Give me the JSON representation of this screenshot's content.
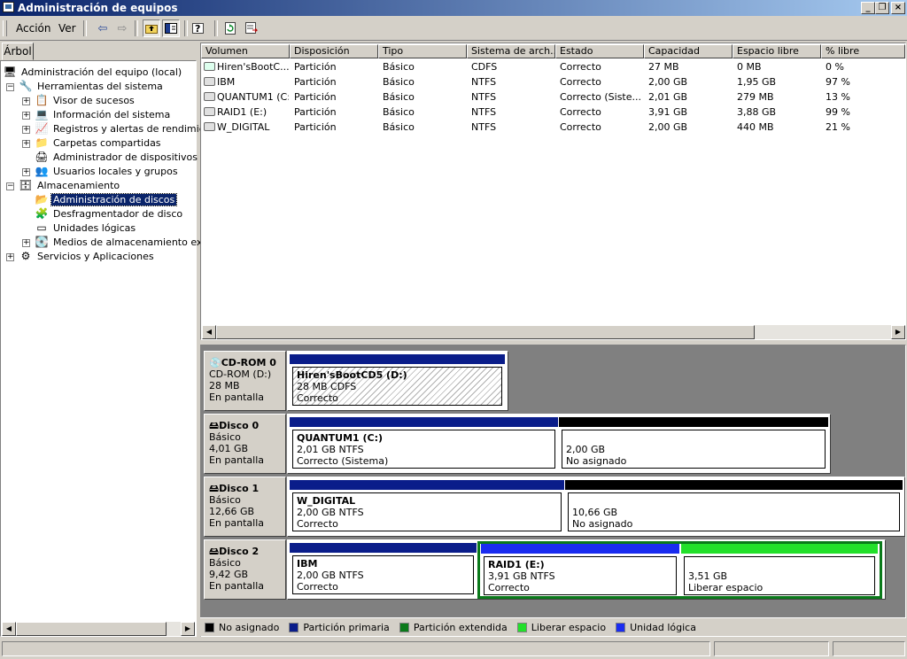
{
  "window": {
    "title": "Administración de equipos"
  },
  "menu": {
    "accion": "Acción",
    "ver": "Ver"
  },
  "toolbar": {
    "icons": [
      "back-arrow-icon",
      "forward-arrow-icon",
      "up-folder-icon",
      "show-hide-tree-icon",
      "help-icon",
      "refresh-icon",
      "export-list-icon"
    ]
  },
  "left_tab": {
    "label": "Árbol"
  },
  "tree": {
    "root": "Administración del equipo (local)",
    "herramientas": "Herramientas del sistema",
    "visor": "Visor de sucesos",
    "informacion": "Información del sistema",
    "registros": "Registros y alertas de rendimiento",
    "carpetas": "Carpetas compartidas",
    "admin_disp": "Administrador de dispositivos",
    "usuarios": "Usuarios locales y grupos",
    "almacenamiento": "Almacenamiento",
    "admin_discos": "Administración de discos",
    "desfrag": "Desfragmentador de disco",
    "unidades": "Unidades lógicas",
    "medios": "Medios de almacenamiento extraíbles",
    "servicios": "Servicios y Aplicaciones"
  },
  "columns": [
    "Volumen",
    "Disposición",
    "Tipo",
    "Sistema de arch...",
    "Estado",
    "Capacidad",
    "Espacio libre",
    "% libre"
  ],
  "volumes": [
    {
      "volumen": "Hiren'sBootC...",
      "disposicion": "Partición",
      "tipo": "Básico",
      "sistema": "CDFS",
      "estado": "Correcto",
      "capacidad": "27 MB",
      "libre": "0 MB",
      "pct": "0 %"
    },
    {
      "volumen": "IBM",
      "disposicion": "Partición",
      "tipo": "Básico",
      "sistema": "NTFS",
      "estado": "Correcto",
      "capacidad": "2,00 GB",
      "libre": "1,95 GB",
      "pct": "97 %"
    },
    {
      "volumen": "QUANTUM1 (C:)",
      "disposicion": "Partición",
      "tipo": "Básico",
      "sistema": "NTFS",
      "estado": "Correcto (Siste...",
      "capacidad": "2,01 GB",
      "libre": "279 MB",
      "pct": "13 %"
    },
    {
      "volumen": "RAID1 (E:)",
      "disposicion": "Partición",
      "tipo": "Básico",
      "sistema": "NTFS",
      "estado": "Correcto",
      "capacidad": "3,91 GB",
      "libre": "3,88 GB",
      "pct": "99 %"
    },
    {
      "volumen": "W_DIGITAL",
      "disposicion": "Partición",
      "tipo": "Básico",
      "sistema": "NTFS",
      "estado": "Correcto",
      "capacidad": "2,00 GB",
      "libre": "440 MB",
      "pct": "21 %"
    }
  ],
  "disks": {
    "cdrom": {
      "name": "CD-ROM 0",
      "l1": "CD-ROM (D:)",
      "l2": "28 MB",
      "l3": "En pantalla",
      "p1": {
        "name": "Hiren'sBootCD5  (D:)",
        "size": "28 MB CDFS",
        "status": "Correcto"
      }
    },
    "d0": {
      "name": "Disco 0",
      "l1": "Básico",
      "l2": "4,01 GB",
      "l3": "En pantalla",
      "p1": {
        "name": "QUANTUM1  (C:)",
        "size": "2,01 GB NTFS",
        "status": "Correcto (Sistema)"
      },
      "p2": {
        "size": "2,00 GB",
        "status": "No asignado"
      }
    },
    "d1": {
      "name": "Disco 1",
      "l1": "Básico",
      "l2": "12,66 GB",
      "l3": "En pantalla",
      "p1": {
        "name": "W_DIGITAL",
        "size": "2,00 GB NTFS",
        "status": "Correcto"
      },
      "p2": {
        "size": "10,66 GB",
        "status": "No asignado"
      }
    },
    "d2": {
      "name": "Disco 2",
      "l1": "Básico",
      "l2": "9,42 GB",
      "l3": "En pantalla",
      "p1": {
        "name": "IBM",
        "size": "2,00 GB NTFS",
        "status": "Correcto"
      },
      "p2": {
        "name": "RAID1  (E:)",
        "size": "3,91 GB NTFS",
        "status": "Correcto"
      },
      "p3": {
        "size": "3,51 GB",
        "status": "Liberar espacio"
      }
    }
  },
  "legend": [
    {
      "label": "No asignado",
      "color": "#000000"
    },
    {
      "label": "Partición primaria",
      "color": "#0a1d8a"
    },
    {
      "label": "Partición extendida",
      "color": "#0a7a1a"
    },
    {
      "label": "Liberar espacio",
      "color": "#22e02a"
    },
    {
      "label": "Unidad lógica",
      "color": "#1a2cf0"
    }
  ],
  "colors": {
    "primary": "#0a1d8a",
    "unallocated": "#000000",
    "extended": "#0a7a1a",
    "free": "#22e02a",
    "logical": "#1a2cf0",
    "title_start": "#0a246a",
    "title_end": "#a6caf0"
  }
}
